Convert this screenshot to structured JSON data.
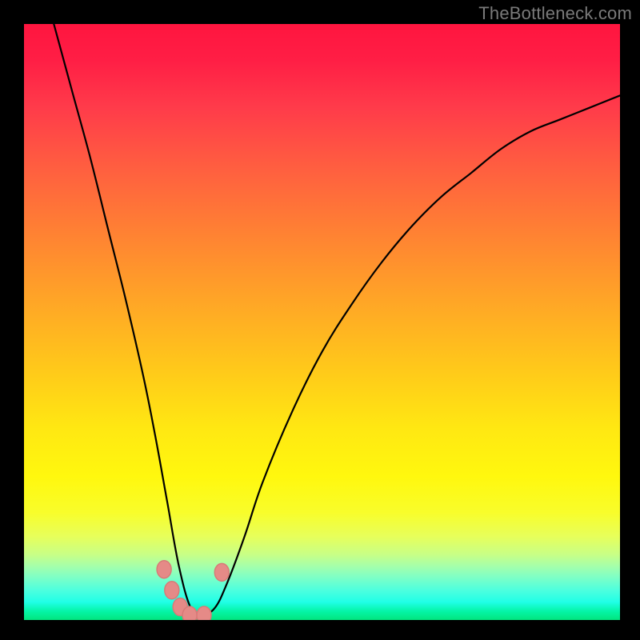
{
  "watermark": "TheBottleneck.com",
  "colors": {
    "background": "#000000",
    "watermark_text": "#7a7a7a",
    "curve_stroke": "#000000",
    "dot_fill": "#e58a87",
    "gradient_top": "#ff153f",
    "gradient_bottom": "#02e57e"
  },
  "chart_data": {
    "type": "line",
    "title": "",
    "xlabel": "",
    "ylabel": "",
    "x_range": [
      0,
      100
    ],
    "y_range": [
      0,
      100
    ],
    "note": "X and Y are normalized 0–100; no axis ticks or numeric labels are shown in the image. The curve is a V-shaped bottleneck profile whose minimum lies near x≈26–30 at y≈0. Values are estimated from pixel positions.",
    "series": [
      {
        "name": "bottleneck-curve",
        "x": [
          5,
          8,
          11,
          14,
          17,
          20,
          22,
          24,
          26,
          28,
          30,
          32,
          34,
          37,
          40,
          45,
          50,
          55,
          60,
          65,
          70,
          75,
          80,
          85,
          90,
          95,
          100
        ],
        "y": [
          100,
          89,
          78,
          66,
          54,
          41,
          31,
          20,
          9,
          2,
          1,
          2,
          6,
          14,
          23,
          35,
          45,
          53,
          60,
          66,
          71,
          75,
          79,
          82,
          84,
          86,
          88
        ]
      }
    ],
    "markers": [
      {
        "name": "dot-left-upper",
        "x": 23.5,
        "y": 8.5
      },
      {
        "name": "dot-left-mid",
        "x": 24.8,
        "y": 5.0
      },
      {
        "name": "dot-left-lower",
        "x": 26.2,
        "y": 2.2
      },
      {
        "name": "dot-valley-left",
        "x": 27.8,
        "y": 0.8
      },
      {
        "name": "dot-valley-right",
        "x": 30.2,
        "y": 0.8
      },
      {
        "name": "dot-right-upper",
        "x": 33.2,
        "y": 8.0
      }
    ]
  }
}
